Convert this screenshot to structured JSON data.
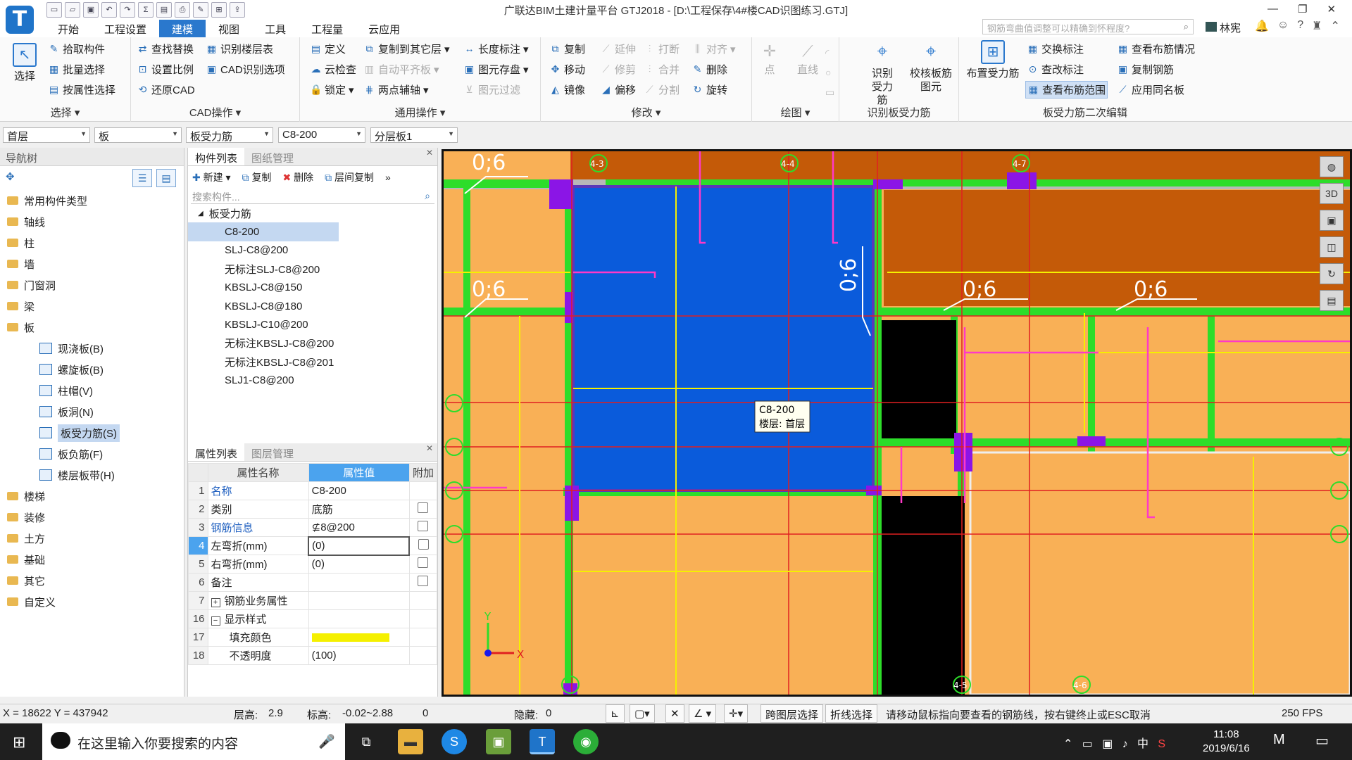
{
  "app": {
    "title": "广联达BIM土建计量平台 GTJ2018 - [D:\\工程保存\\4#楼CAD识图练习.GTJ]",
    "logo": "T",
    "help_placeholder": "钢筋弯曲值调整可以精确到怀程度?",
    "user": "林宪"
  },
  "menu": [
    "开始",
    "工程设置",
    "建模",
    "视图",
    "工具",
    "工程量",
    "云应用"
  ],
  "ribbon": {
    "select": {
      "big": "选择",
      "items": [
        "拾取构件",
        "批量选择",
        "按属性选择"
      ],
      "label": "选择"
    },
    "cad": {
      "items": [
        "查找替换",
        "设置比例",
        "还原CAD",
        "识别楼层表",
        "CAD识别选项"
      ],
      "label": "CAD操作"
    },
    "general": {
      "items": [
        "定义",
        "云检查",
        "锁定",
        "复制到其它层",
        "自动平齐板",
        "两点辅轴",
        "长度标注",
        "图元存盘",
        "图元过滤"
      ],
      "label": "通用操作"
    },
    "modify": {
      "items": [
        "复制",
        "移动",
        "镜像",
        "延伸",
        "修剪",
        "偏移",
        "打断",
        "合并",
        "分割",
        "对齐",
        "删除",
        "旋转"
      ],
      "label": "修改"
    },
    "draw": {
      "items": [
        "点",
        "直线"
      ],
      "label": "绘图"
    },
    "recognize": {
      "items": [
        "识别受力筋",
        "校核板筋图元"
      ],
      "label": "识别板受力筋"
    },
    "edit2": {
      "big": "布置受力筋",
      "items": [
        "交换标注",
        "查改标注",
        "查看布筋范围",
        "查看布筋情况",
        "复制钢筋",
        "应用同名板"
      ],
      "label": "板受力筋二次编辑"
    }
  },
  "filters": [
    "首层",
    "板",
    "板受力筋",
    "C8-200",
    "分层板1"
  ],
  "nav": {
    "title": "导航树",
    "items": [
      {
        "label": "常用构件类型",
        "type": "folder"
      },
      {
        "label": "轴线",
        "type": "folder"
      },
      {
        "label": "柱",
        "type": "folder"
      },
      {
        "label": "墙",
        "type": "folder"
      },
      {
        "label": "门窗洞",
        "type": "folder"
      },
      {
        "label": "梁",
        "type": "folder"
      },
      {
        "label": "板",
        "type": "folder"
      },
      {
        "label": "现浇板(B)",
        "type": "sub"
      },
      {
        "label": "螺旋板(B)",
        "type": "sub"
      },
      {
        "label": "柱帽(V)",
        "type": "sub"
      },
      {
        "label": "板洞(N)",
        "type": "sub"
      },
      {
        "label": "板受力筋(S)",
        "type": "sub",
        "selected": true
      },
      {
        "label": "板负筋(F)",
        "type": "sub"
      },
      {
        "label": "楼层板带(H)",
        "type": "sub"
      },
      {
        "label": "楼梯",
        "type": "folder"
      },
      {
        "label": "装修",
        "type": "folder"
      },
      {
        "label": "土方",
        "type": "folder"
      },
      {
        "label": "基础",
        "type": "folder"
      },
      {
        "label": "其它",
        "type": "folder"
      },
      {
        "label": "自定义",
        "type": "folder"
      }
    ]
  },
  "components": {
    "tabs": [
      "构件列表",
      "图纸管理"
    ],
    "tools": [
      "新建",
      "复制",
      "删除",
      "层间复制"
    ],
    "search_placeholder": "搜索构件...",
    "group": "板受力筋",
    "items": [
      "C8-200",
      "SLJ-C8@200",
      "无标注SLJ-C8@200",
      "KBSLJ-C8@150",
      "KBSLJ-C8@180",
      "KBSLJ-C10@200",
      "无标注KBSLJ-C8@200",
      "无标注KBSLJ-C8@201",
      "SLJ1-C8@200"
    ]
  },
  "properties": {
    "tabs": [
      "属性列表",
      "图层管理"
    ],
    "headers": [
      "属性名称",
      "属性值",
      "附加"
    ],
    "rows": [
      {
        "n": "1",
        "name": "名称",
        "value": "C8-200",
        "blue": true,
        "cb": false
      },
      {
        "n": "2",
        "name": "类别",
        "value": "底筋",
        "blue": false,
        "cb": true
      },
      {
        "n": "3",
        "name": "钢筋信息",
        "value": "⊈8@200",
        "blue": true,
        "cb": true
      },
      {
        "n": "4",
        "name": "左弯折(mm)",
        "value": "(0)",
        "blue": false,
        "cb": true
      },
      {
        "n": "5",
        "name": "右弯折(mm)",
        "value": "(0)",
        "blue": false,
        "cb": true
      },
      {
        "n": "6",
        "name": "备注",
        "value": "",
        "blue": false,
        "cb": true
      },
      {
        "n": "7",
        "name": "钢筋业务属性",
        "value": "",
        "blue": false,
        "cb": false,
        "expand": "+"
      },
      {
        "n": "16",
        "name": "显示样式",
        "value": "",
        "blue": false,
        "cb": false,
        "expand": "−"
      },
      {
        "n": "17",
        "name": "填充颜色",
        "value": "",
        "blue": false,
        "cb": false,
        "color": "#f5f000"
      },
      {
        "n": "18",
        "name": "不透明度",
        "value": "(100)",
        "blue": false,
        "cb": false
      }
    ]
  },
  "canvas": {
    "tooltip": [
      "C8-200",
      "楼层: 首层"
    ],
    "labels": [
      "0;6",
      "0;6",
      "0;6",
      "0;6",
      "0;6"
    ],
    "axes": [
      "4-3",
      "4-4",
      "4-7",
      "4-5",
      "4-6"
    ],
    "x_label": "X",
    "y_label": "Y"
  },
  "status": {
    "coord": "X = 18622 Y = 437942",
    "floor_h_label": "层高:",
    "floor_h": "2.9",
    "elev_label": "标高:",
    "elev": "-0.02~2.88",
    "zero": "0",
    "hidden_label": "隐藏:",
    "hidden": "0",
    "btn1": "跨图层选择",
    "btn2": "折线选择",
    "hint": "请移动鼠标指向要查看的钢筋线，按右键终止或ESC取消",
    "fps": "250 FPS"
  },
  "taskbar": {
    "search": "在这里输入你要搜索的内容",
    "time": "11:08",
    "date": "2019/6/16",
    "ime": "中"
  }
}
